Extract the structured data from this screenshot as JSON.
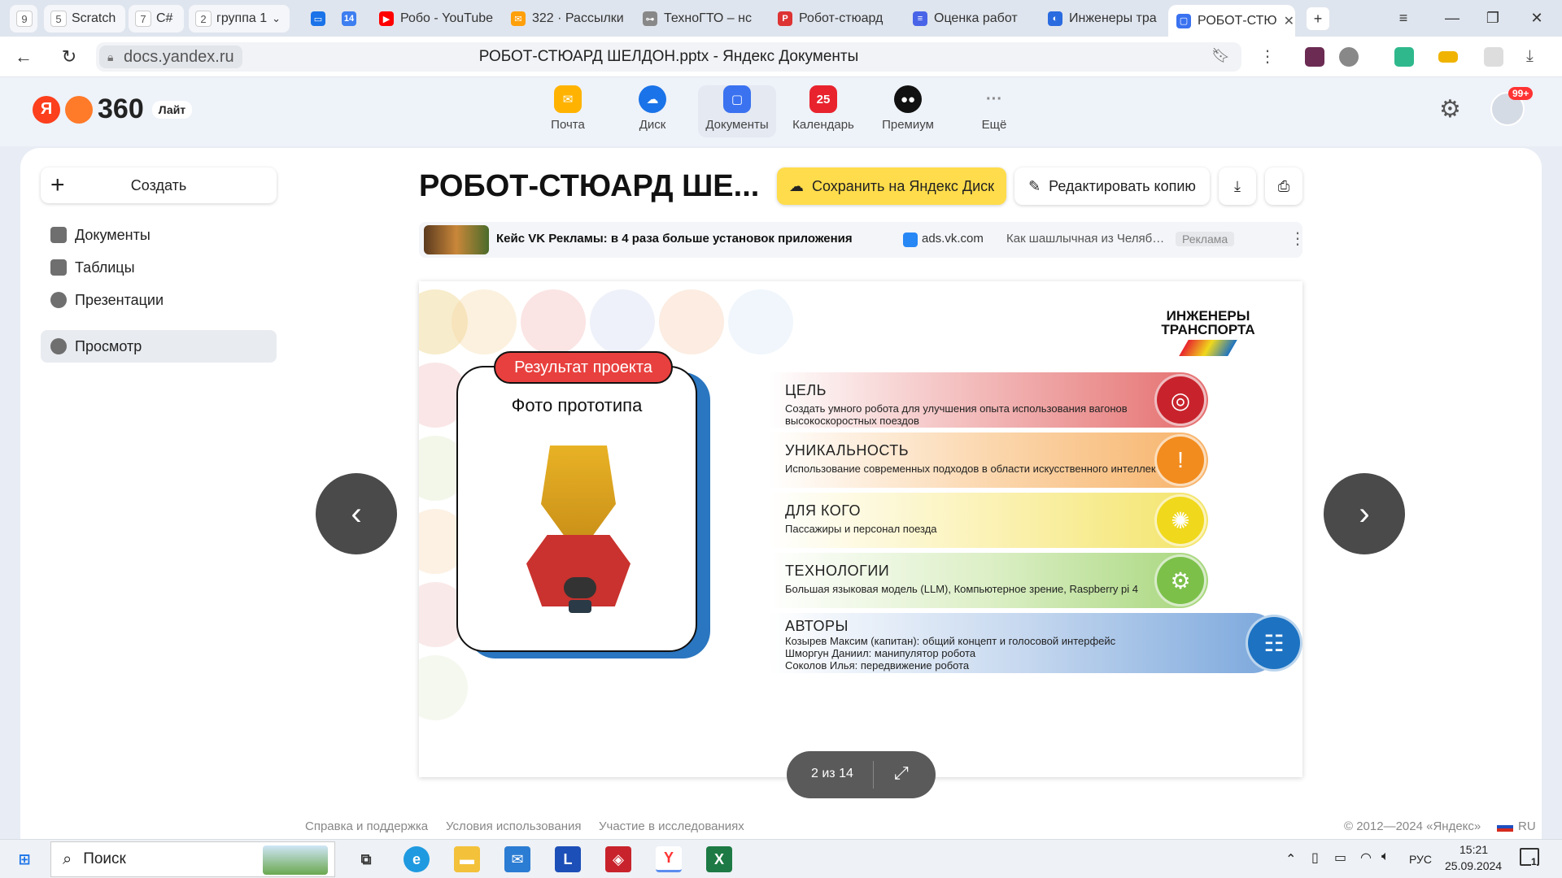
{
  "browser": {
    "tabs": [
      {
        "count": "9",
        "label": ""
      },
      {
        "count": "5",
        "label": "Scratch"
      },
      {
        "count": "7",
        "label": "C#"
      },
      {
        "count": "2",
        "label": "группа 1"
      },
      {
        "count": "14",
        "label": ""
      },
      {
        "label": "Робо - YouTube"
      },
      {
        "label": "322 · Рассылки"
      },
      {
        "label": "ТехноГТО – нс"
      },
      {
        "label": "Робот-стюард"
      },
      {
        "label": "Оценка работ"
      },
      {
        "label": "Инженеры тра"
      },
      {
        "label": "РОБОТ-СТЮ"
      }
    ],
    "url": "docs.yandex.ru",
    "page_title": "РОБОТ-СТЮАРД ШЕЛДОН.pptx - Яндекс Документы"
  },
  "header": {
    "logo_text": "360",
    "plan_badge": "Лайт",
    "services": [
      "Почта",
      "Диск",
      "Документы",
      "Календарь",
      "Премиум",
      "Ещё"
    ],
    "calendar_day": "25",
    "notifications": "99+"
  },
  "sidebar": {
    "create_label": "Создать",
    "items": [
      "Документы",
      "Таблицы",
      "Презентации"
    ],
    "view_label": "Просмотр"
  },
  "doc": {
    "title": "РОБОТ-СТЮАРД ШЕ...",
    "save_label": "Сохранить на Яндекс Диск",
    "edit_label": "Редактировать копию"
  },
  "ad": {
    "headline": "Кейс VK Рекламы: в 4 раза больше установок приложения",
    "domain": "ads.vk.com",
    "snippet": "Как шашлычная из Челяб…",
    "badge": "Реклама"
  },
  "slide": {
    "logo_line1": "ИНЖЕНЕРЫ",
    "logo_line2": "ТРАНСПОРТА",
    "result_label": "Результат проекта",
    "photo_caption": "Фото прототипа",
    "rows": [
      {
        "title": "ЦЕЛЬ",
        "text": "Создать умного робота для улучшения опыта использования вагонов высокоскоростных поездов",
        "color": "#c8232c"
      },
      {
        "title": "УНИКАЛЬНОСТЬ",
        "text": "Использование современных подходов в области искусственного интеллекта",
        "color": "#f28c1e"
      },
      {
        "title": "ДЛЯ КОГО",
        "text": "Пассажиры и персонал поезда",
        "color": "#f0d81c"
      },
      {
        "title": "ТЕХНОЛОГИИ",
        "text": "Большая языковая модель (LLM), Компьютерное зрение, Raspberry pi 4",
        "color": "#7cc04a"
      },
      {
        "title": "АВТОРЫ",
        "text": "Козырев Максим (капитан): общий концепт и голосовой интерфейс\nШморгун Даниил: манипулятор робота\nСоколов Илья: передвижение робота",
        "color": "#1d72c2"
      }
    ],
    "page_indicator": "2 из 14"
  },
  "footer": {
    "links": [
      "Справка и поддержка",
      "Условия использования",
      "Участие в исследованиях"
    ],
    "copyright": "© 2012—2024 «Яндекс»",
    "lang": "RU"
  },
  "taskbar": {
    "search_label": "Поиск",
    "lang": "РУС",
    "time": "15:21",
    "date": "25.09.2024",
    "notif_count": "1"
  }
}
